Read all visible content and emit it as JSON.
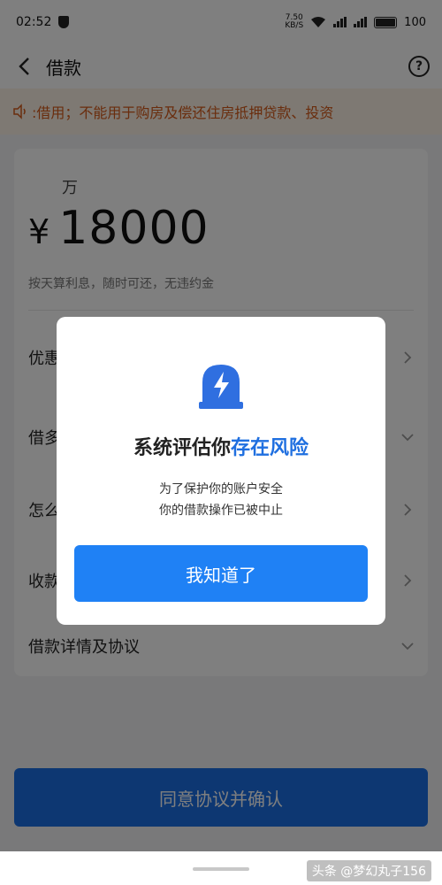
{
  "status_bar": {
    "time": "02:52",
    "net_speed_value": "7.50",
    "net_speed_unit": "KB/S",
    "battery": "100"
  },
  "nav": {
    "title": "借款",
    "help_label": "?"
  },
  "notice": {
    "text": ":借用；不能用于购房及偿还住房抵押贷款、投资"
  },
  "loan": {
    "unit_label": "万",
    "currency_symbol": "¥",
    "amount": "18000",
    "hint": "按天算利息，随时可还，无违约金"
  },
  "rows": [
    {
      "label": "优惠"
    },
    {
      "label": "借多"
    },
    {
      "label": "怎么"
    },
    {
      "label": "收款"
    },
    {
      "label": "借款详情及协议"
    }
  ],
  "confirm_button": {
    "label": "同意协议并确认"
  },
  "watermark": {
    "text": "头条 @梦幻丸子156"
  },
  "dialog": {
    "icon": "shield-lightning-icon",
    "title_normal": "系统评估你",
    "title_highlight": "存在风险",
    "line1": "为了保护你的账户安全",
    "line2": "你的借款操作已被中止",
    "button_label": "我知道了",
    "highlight_color": "#1f6fe0",
    "button_color": "#1f81f5"
  }
}
